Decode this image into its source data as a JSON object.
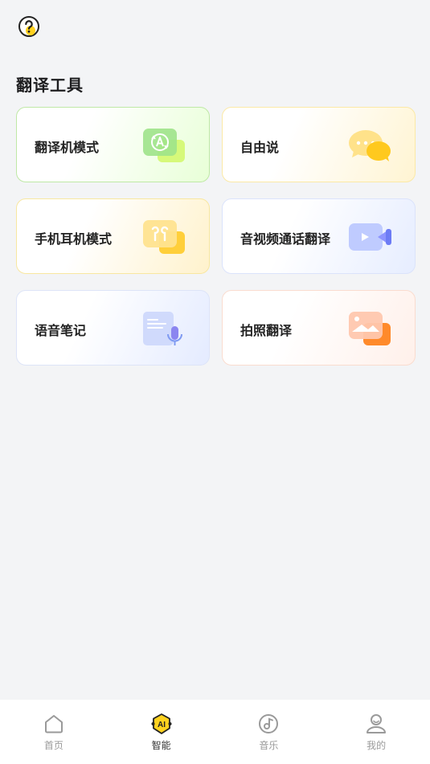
{
  "header": {
    "help_icon": "question-circle-icon",
    "section_title": "翻译工具"
  },
  "tools": [
    {
      "label": "翻译机模式",
      "icon": "translator-device-icon",
      "theme": "green"
    },
    {
      "label": "自由说",
      "icon": "chat-bubbles-icon",
      "theme": "yellow"
    },
    {
      "label": "手机耳机模式",
      "icon": "earphones-icon",
      "theme": "yellow"
    },
    {
      "label": "音视频通话翻译",
      "icon": "video-call-icon",
      "theme": "blue"
    },
    {
      "label": "语音笔记",
      "icon": "voice-note-icon",
      "theme": "blue"
    },
    {
      "label": "拍照翻译",
      "icon": "photo-icon",
      "theme": "orange"
    }
  ],
  "tabbar": {
    "items": [
      {
        "label": "首页",
        "icon": "home-icon",
        "active": false
      },
      {
        "label": "智能",
        "icon": "ai-icon",
        "active": true
      },
      {
        "label": "音乐",
        "icon": "music-icon",
        "active": false
      },
      {
        "label": "我的",
        "icon": "profile-icon",
        "active": false
      }
    ]
  },
  "colors": {
    "accent_yellow": "#ffd21f",
    "background": "#f3f4f6"
  }
}
